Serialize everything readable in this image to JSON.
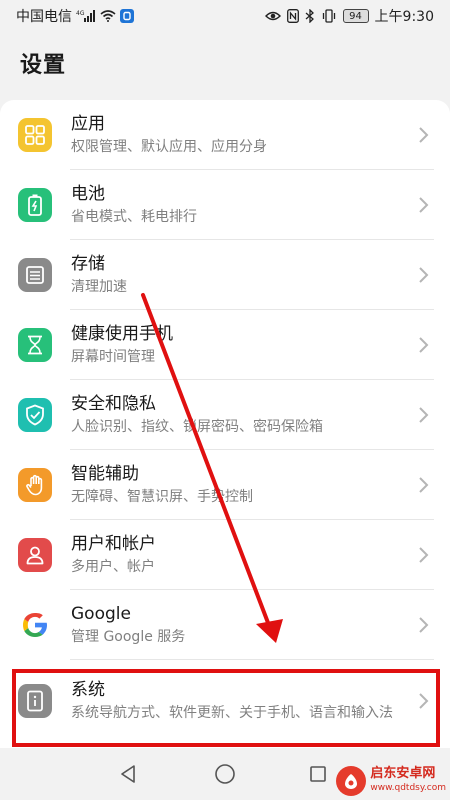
{
  "status_bar": {
    "carrier": "中国电信",
    "signal_label": "4G",
    "battery": "94",
    "time": "上午9:30"
  },
  "header": {
    "title": "设置"
  },
  "settings": [
    {
      "id": "apps",
      "title": "应用",
      "subtitle": "权限管理、默认应用、应用分身",
      "icon": "apps-grid-icon",
      "color": "#f4c430"
    },
    {
      "id": "battery",
      "title": "电池",
      "subtitle": "省电模式、耗电排行",
      "icon": "battery-icon",
      "color": "#27c07a"
    },
    {
      "id": "storage",
      "title": "存储",
      "subtitle": "清理加速",
      "icon": "storage-icon",
      "color": "#8a8a8a"
    },
    {
      "id": "digital-balance",
      "title": "健康使用手机",
      "subtitle": "屏幕时间管理",
      "icon": "hourglass-icon",
      "color": "#27c07a"
    },
    {
      "id": "security",
      "title": "安全和隐私",
      "subtitle": "人脸识别、指纹、锁屏密码、密码保险箱",
      "icon": "shield-icon",
      "color": "#1fbfb0"
    },
    {
      "id": "accessibility",
      "title": "智能辅助",
      "subtitle": "无障碍、智慧识屏、手势控制",
      "icon": "hand-icon",
      "color": "#f39a2a"
    },
    {
      "id": "users",
      "title": "用户和帐户",
      "subtitle": "多用户、帐户",
      "icon": "user-icon",
      "color": "#e24b4b"
    },
    {
      "id": "google",
      "title": "Google",
      "subtitle": "管理 Google 服务",
      "icon": "google-icon",
      "color": "#ffffff"
    },
    {
      "id": "system",
      "title": "系统",
      "subtitle": "系统导航方式、软件更新、关于手机、语言和输入法",
      "icon": "info-icon",
      "color": "#8a8a8a"
    }
  ],
  "watermark": {
    "name": "启东安卓网",
    "url": "www.qdtdsy.com"
  },
  "colors": {
    "annotation": "#e01010"
  }
}
